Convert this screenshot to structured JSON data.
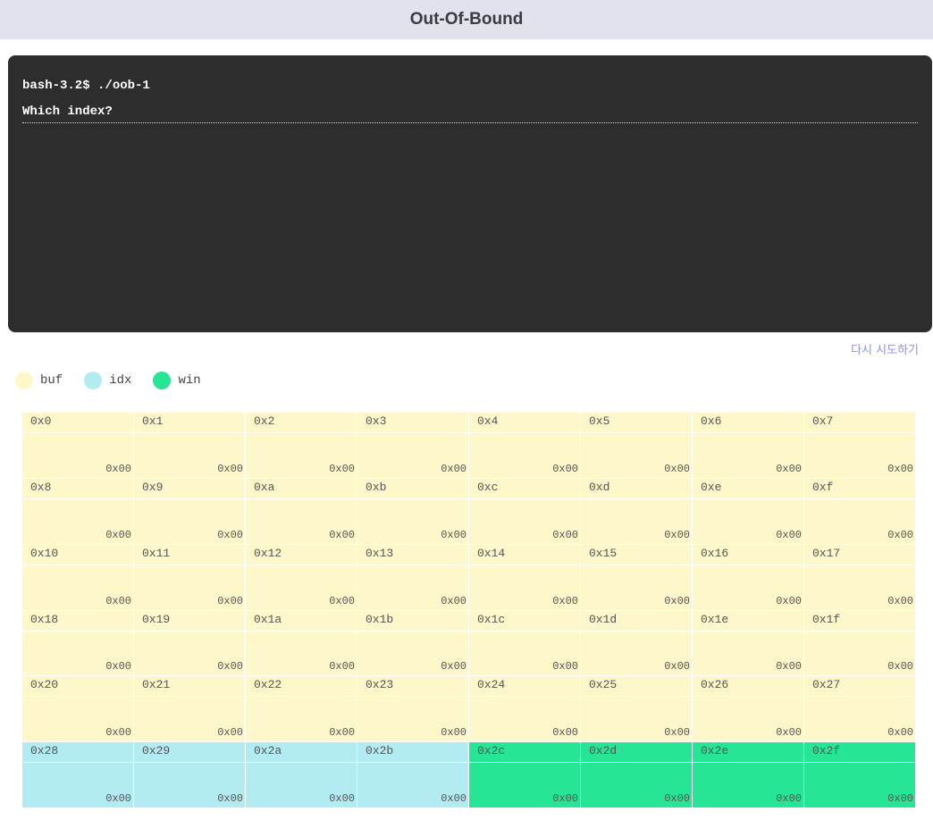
{
  "header": {
    "title": "Out-Of-Bound"
  },
  "terminal": {
    "lines": [
      "bash-3.2$ ./oob-1",
      "Which index?"
    ]
  },
  "retry_label": "다시 시도하기",
  "legend": [
    {
      "label": "buf",
      "color": "#fef7c9"
    },
    {
      "label": "idx",
      "color": "#b2ecf2"
    },
    {
      "label": "win",
      "color": "#26e595"
    }
  ],
  "colors": {
    "buf": "#fef7c9",
    "idx": "#b2ecf2",
    "win": "#26e595"
  },
  "memory": [
    {
      "addr": "0x0",
      "value": "0x00",
      "region": "buf"
    },
    {
      "addr": "0x1",
      "value": "0x00",
      "region": "buf"
    },
    {
      "addr": "0x2",
      "value": "0x00",
      "region": "buf"
    },
    {
      "addr": "0x3",
      "value": "0x00",
      "region": "buf"
    },
    {
      "addr": "0x4",
      "value": "0x00",
      "region": "buf"
    },
    {
      "addr": "0x5",
      "value": "0x00",
      "region": "buf"
    },
    {
      "addr": "0x6",
      "value": "0x00",
      "region": "buf"
    },
    {
      "addr": "0x7",
      "value": "0x00",
      "region": "buf"
    },
    {
      "addr": "0x8",
      "value": "0x00",
      "region": "buf"
    },
    {
      "addr": "0x9",
      "value": "0x00",
      "region": "buf"
    },
    {
      "addr": "0xa",
      "value": "0x00",
      "region": "buf"
    },
    {
      "addr": "0xb",
      "value": "0x00",
      "region": "buf"
    },
    {
      "addr": "0xc",
      "value": "0x00",
      "region": "buf"
    },
    {
      "addr": "0xd",
      "value": "0x00",
      "region": "buf"
    },
    {
      "addr": "0xe",
      "value": "0x00",
      "region": "buf"
    },
    {
      "addr": "0xf",
      "value": "0x00",
      "region": "buf"
    },
    {
      "addr": "0x10",
      "value": "0x00",
      "region": "buf"
    },
    {
      "addr": "0x11",
      "value": "0x00",
      "region": "buf"
    },
    {
      "addr": "0x12",
      "value": "0x00",
      "region": "buf"
    },
    {
      "addr": "0x13",
      "value": "0x00",
      "region": "buf"
    },
    {
      "addr": "0x14",
      "value": "0x00",
      "region": "buf"
    },
    {
      "addr": "0x15",
      "value": "0x00",
      "region": "buf"
    },
    {
      "addr": "0x16",
      "value": "0x00",
      "region": "buf"
    },
    {
      "addr": "0x17",
      "value": "0x00",
      "region": "buf"
    },
    {
      "addr": "0x18",
      "value": "0x00",
      "region": "buf"
    },
    {
      "addr": "0x19",
      "value": "0x00",
      "region": "buf"
    },
    {
      "addr": "0x1a",
      "value": "0x00",
      "region": "buf"
    },
    {
      "addr": "0x1b",
      "value": "0x00",
      "region": "buf"
    },
    {
      "addr": "0x1c",
      "value": "0x00",
      "region": "buf"
    },
    {
      "addr": "0x1d",
      "value": "0x00",
      "region": "buf"
    },
    {
      "addr": "0x1e",
      "value": "0x00",
      "region": "buf"
    },
    {
      "addr": "0x1f",
      "value": "0x00",
      "region": "buf"
    },
    {
      "addr": "0x20",
      "value": "0x00",
      "region": "buf"
    },
    {
      "addr": "0x21",
      "value": "0x00",
      "region": "buf"
    },
    {
      "addr": "0x22",
      "value": "0x00",
      "region": "buf"
    },
    {
      "addr": "0x23",
      "value": "0x00",
      "region": "buf"
    },
    {
      "addr": "0x24",
      "value": "0x00",
      "region": "buf"
    },
    {
      "addr": "0x25",
      "value": "0x00",
      "region": "buf"
    },
    {
      "addr": "0x26",
      "value": "0x00",
      "region": "buf"
    },
    {
      "addr": "0x27",
      "value": "0x00",
      "region": "buf"
    },
    {
      "addr": "0x28",
      "value": "0x00",
      "region": "idx"
    },
    {
      "addr": "0x29",
      "value": "0x00",
      "region": "idx"
    },
    {
      "addr": "0x2a",
      "value": "0x00",
      "region": "idx"
    },
    {
      "addr": "0x2b",
      "value": "0x00",
      "region": "idx"
    },
    {
      "addr": "0x2c",
      "value": "0x00",
      "region": "win"
    },
    {
      "addr": "0x2d",
      "value": "0x00",
      "region": "win"
    },
    {
      "addr": "0x2e",
      "value": "0x00",
      "region": "win"
    },
    {
      "addr": "0x2f",
      "value": "0x00",
      "region": "win"
    }
  ]
}
